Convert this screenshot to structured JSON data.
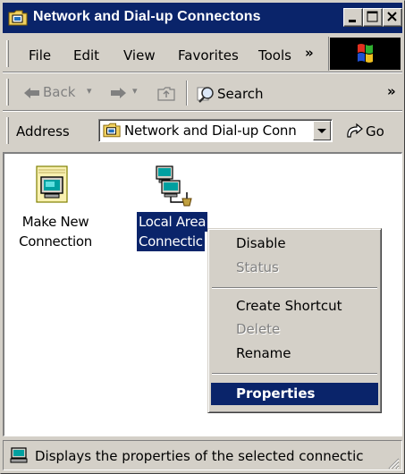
{
  "window": {
    "title": "Network and Dial-up Connectons",
    "controls": {
      "minimize": "minimize",
      "maximize": "maximize",
      "close": "close"
    }
  },
  "menu": {
    "items": [
      "File",
      "Edit",
      "View",
      "Favorites",
      "Tools"
    ],
    "overflow": "»"
  },
  "toolbar": {
    "back_label": "Back",
    "forward_label": "",
    "search_label": "Search",
    "overflow": "»"
  },
  "address": {
    "label": "Address",
    "value": "Network and Dial-up Conn",
    "go_label": "Go"
  },
  "icons": [
    {
      "label_line1": "Make New",
      "label_line2": "Connection",
      "selected": false
    },
    {
      "label_line1": "Local Area",
      "label_line2": "Connectic",
      "selected": true
    }
  ],
  "context_menu": {
    "items": [
      {
        "label": "Disable",
        "state": "normal"
      },
      {
        "label": "Status",
        "state": "disabled"
      },
      {
        "label": "Create Shortcut",
        "state": "normal"
      },
      {
        "label": "Delete",
        "state": "disabled"
      },
      {
        "label": "Rename",
        "state": "normal"
      },
      {
        "label": "Properties",
        "state": "selected"
      }
    ]
  },
  "status_bar": {
    "text": "Displays the properties of the selected connectic"
  },
  "colors": {
    "title_bar": "#0a246a",
    "face": "#d4d0c8",
    "selection": "#0a246a"
  }
}
